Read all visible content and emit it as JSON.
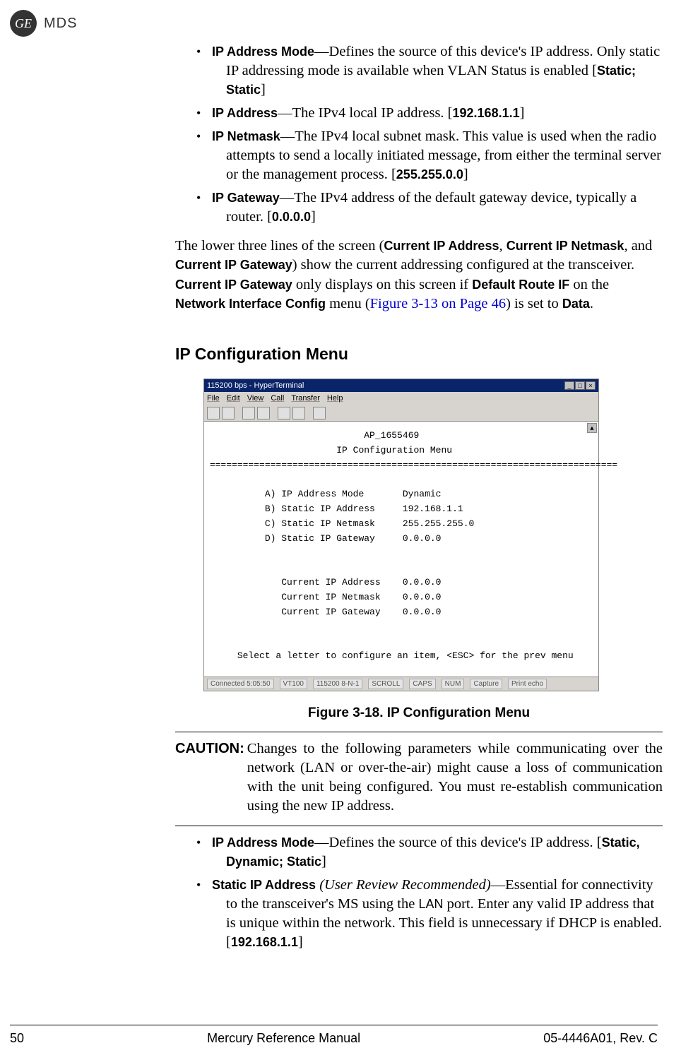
{
  "header": {
    "ge_badge": "GE",
    "brand": "MDS"
  },
  "bullets_top": {
    "item1": {
      "term": "IP Address Mode",
      "desc_a": "—Defines the source of this device's IP address. Only static IP addressing mode is available when VLAN Status is enabled [",
      "val": "Static; Static",
      "desc_b": "]"
    },
    "item2": {
      "term": "IP Address",
      "desc_a": "—The IPv4 local IP address. [",
      "val": "192.168.1.1",
      "desc_b": "]"
    },
    "item3": {
      "term": "IP Netmask",
      "desc_a": "—The IPv4 local subnet mask. This value is used when the radio attempts to send a locally initiated message, from either the terminal server or the management process. [",
      "val": "255.255.0.0",
      "desc_b": "]"
    },
    "item4": {
      "term": "IP Gateway",
      "desc_a": "—The IPv4 address of the default gateway device, typically a router. [",
      "val": "0.0.0.0",
      "desc_b": "]"
    }
  },
  "para1": {
    "t1": "The lower three lines of the screen (",
    "b1": "Current IP Address",
    "t2": ", ",
    "b2": "Current IP Netmask",
    "t3": ", and ",
    "b3": "Current IP Gateway",
    "t4": ") show the current addressing configured at the transceiver. ",
    "b4": "Current IP Gateway",
    "t5": " only displays on this screen if ",
    "b5": "Default Route IF",
    "t6": " on the ",
    "b6": "Network Interface Config",
    "t7": " menu (",
    "link": "Figure 3-13 on Page 46",
    "t8": ") is set to ",
    "b7": "Data",
    "t9": "."
  },
  "section_heading": "IP Configuration Menu",
  "terminal": {
    "title": "115200 bps - HyperTerminal",
    "menus": {
      "m1": "File",
      "m2": "Edit",
      "m3": "View",
      "m4": "Call",
      "m5": "Transfer",
      "m6": "Help"
    },
    "body_title": "AP_1655469",
    "body_sub": "IP Configuration Menu",
    "rule": "==========================================================================",
    "rowA_l": "A) IP Address Mode",
    "rowA_v": "Dynamic",
    "rowB_l": "B) Static IP Address",
    "rowB_v": "192.168.1.1",
    "rowC_l": "C) Static IP Netmask",
    "rowC_v": "255.255.255.0",
    "rowD_l": "D) Static IP Gateway",
    "rowD_v": "0.0.0.0",
    "cur1_l": "Current IP Address",
    "cur1_v": "0.0.0.0",
    "cur2_l": "Current IP Netmask",
    "cur2_v": "0.0.0.0",
    "cur3_l": "Current IP Gateway",
    "cur3_v": "0.0.0.0",
    "prompt": "Select a letter to configure an item, <ESC> for the prev menu",
    "status": {
      "s1": "Connected 5:05:50",
      "s2": "VT100",
      "s3": "115200 8-N-1",
      "s4": "SCROLL",
      "s5": "CAPS",
      "s6": "NUM",
      "s7": "Capture",
      "s8": "Print echo"
    }
  },
  "figure_caption": "Figure 3-18. IP Configuration Menu",
  "caution": {
    "label": "CAUTION:",
    "text": "Changes to the following parameters while communicating over the network (LAN or over-the-air) might cause a loss of communication with the unit being configured. You must re-establish communication using the new IP address."
  },
  "bullets_bottom": {
    "item1": {
      "term": "IP Address Mode",
      "desc_a": "—Defines the source of this device's IP address. [",
      "val": "Static, Dynamic; Static",
      "desc_b": "]"
    },
    "item2": {
      "term": "Static IP Address",
      "ital": " (User Review Recommended)",
      "desc_a": "—Essential for connectivity to the transceiver's MS using the ",
      "small": "LAN",
      "desc_b": " port. Enter any valid IP address that is unique within the network. This field is unnecessary if DHCP is enabled. [",
      "val": "192.168.1.1",
      "desc_c": "]"
    }
  },
  "footer": {
    "page": "50",
    "title": "Mercury Reference Manual",
    "doc": "05-4446A01, Rev. C"
  }
}
